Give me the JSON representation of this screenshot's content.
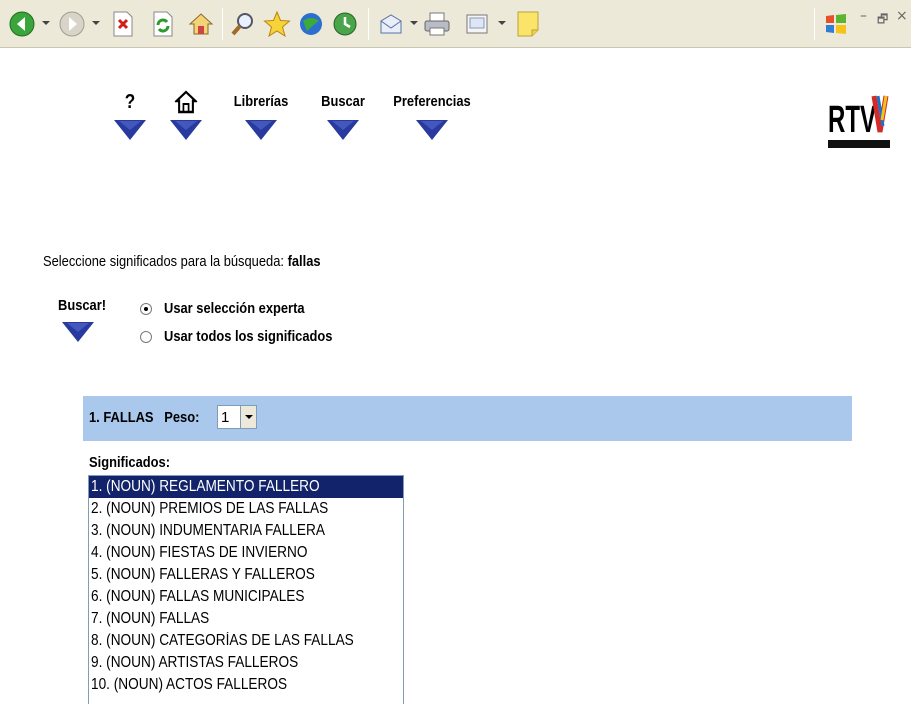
{
  "browser": {
    "toolbar_icons": [
      "back-icon",
      "forward-icon",
      "stop-icon",
      "refresh-icon",
      "home-icon",
      "search-icon",
      "favorites-icon",
      "media-icon",
      "history-icon",
      "mail-icon",
      "print-icon",
      "edit-icon",
      "note-icon"
    ],
    "window_controls": {
      "minimize": "–",
      "restore": "🗗",
      "close": "×"
    }
  },
  "nav": {
    "help": "?",
    "home_icon": "home-icon",
    "librerias": "Librerías",
    "buscar": "Buscar",
    "preferencias": "Preferencias"
  },
  "logo": {
    "text": "RTVV"
  },
  "search": {
    "prompt": "Seleccione significados para la búsqueda:",
    "term": "fallas",
    "button": "Buscar!",
    "option_expert": "Usar selección experta",
    "option_all": "Usar todos los significados",
    "selected_option": "expert"
  },
  "result": {
    "title": "1. FALLAS",
    "peso_label": "Peso:",
    "peso_value": "1",
    "significados_label": "Significados:",
    "options": [
      "1. (NOUN) REGLAMENTO FALLERO",
      "2. (NOUN) PREMIOS DE LAS FALLAS",
      "3. (NOUN) INDUMENTARIA FALLERA",
      "4. (NOUN) FIESTAS DE INVIERNO",
      "5. (NOUN) FALLERAS Y FALLEROS",
      "6. (NOUN) FALLAS MUNICIPALES",
      "7. (NOUN) FALLAS",
      "8. (NOUN) CATEGORÍAS DE LAS FALLAS",
      "9. (NOUN) ARTISTAS FALLEROS",
      "10. (NOUN) ACTOS FALLEROS"
    ],
    "selected_index": 0
  },
  "colors": {
    "header_band": "#a9c8ec",
    "nav_triangle": "#283a9e",
    "selection": "#13236b",
    "toolbar": "#ece9d8"
  }
}
